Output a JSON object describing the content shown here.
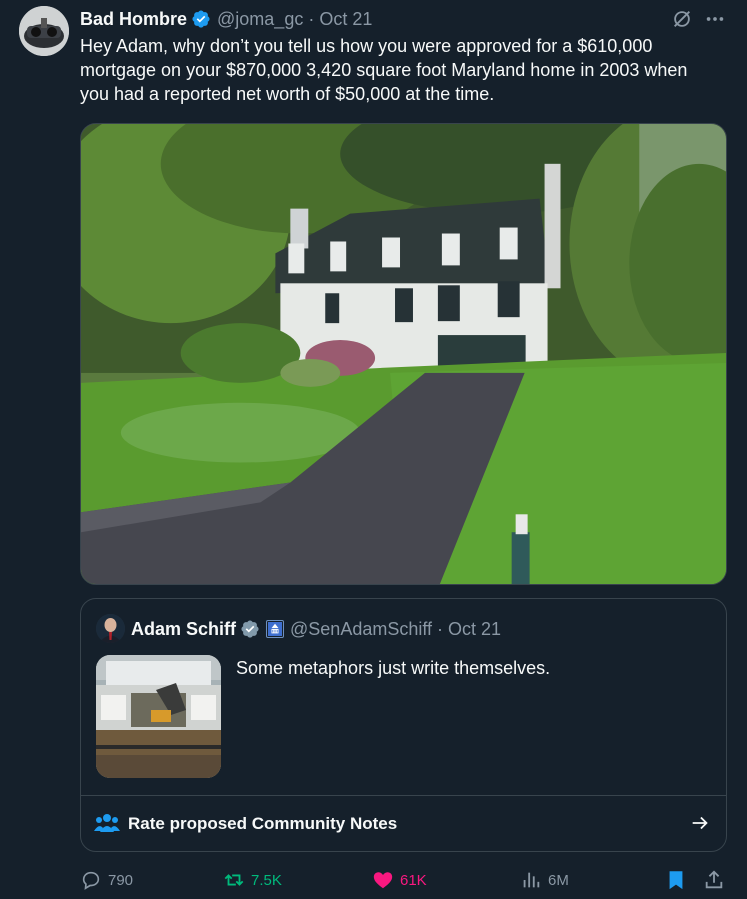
{
  "tweet": {
    "display_name": "Bad Hombre",
    "handle": "@joma_gc",
    "separator": "·",
    "date": "Oct 21",
    "text": "Hey Adam, why don’t you tell us how you were approved for a $610,000 mortgage on your $870,000 3,420 square foot Maryland home in 2003 when you had a reported net worth of $50,000 at the time."
  },
  "quote": {
    "display_name": "Adam Schiff",
    "handle": "@SenAdamSchiff",
    "separator": "·",
    "date": "Oct 21",
    "text": "Some metaphors just write themselves."
  },
  "community_notes": {
    "label": "Rate proposed Community Notes"
  },
  "actions": {
    "replies": "790",
    "retweets": "7.5K",
    "likes": "61K",
    "views": "6M"
  },
  "icons": {
    "verified": "verified-badge-icon",
    "grok": "grok-icon",
    "more": "more-icon",
    "reply": "reply-icon",
    "retweet": "retweet-icon",
    "like": "heart-icon",
    "views": "views-chart-icon",
    "bookmark": "bookmark-icon",
    "share": "share-icon",
    "notes": "people-icon",
    "arrow": "arrow-right-icon"
  },
  "colors": {
    "background": "#15202b",
    "text_primary": "#f7f9f9",
    "text_secondary": "#8b98a5",
    "verified_blue": "#1d9bf0",
    "retweet_green": "#00ba7c",
    "like_pink": "#f91880",
    "border": "#38444d"
  }
}
